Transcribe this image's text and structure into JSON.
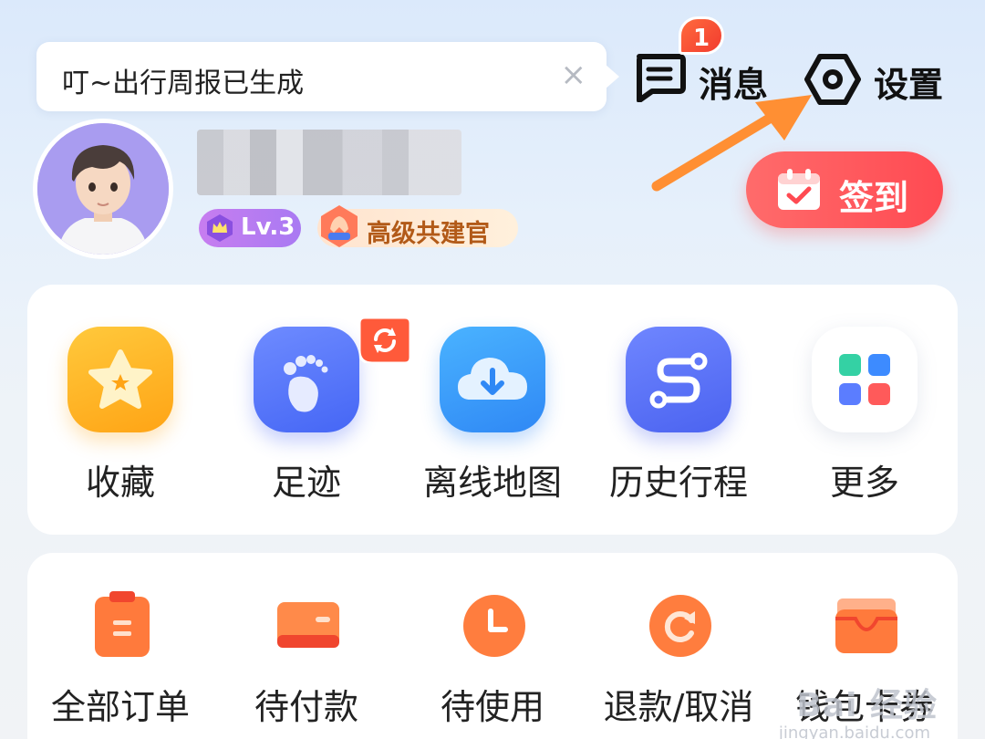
{
  "toast": {
    "text": "叮~出行周报已生成",
    "close": "×"
  },
  "header": {
    "messages": {
      "label": "消息",
      "badge": "1"
    },
    "settings": {
      "label": "设置"
    }
  },
  "profile": {
    "level": "Lv.3",
    "title": "高级共建官"
  },
  "signin": {
    "label": "签到"
  },
  "quick_actions": [
    {
      "label": "收藏",
      "icon": "star-icon"
    },
    {
      "label": "足迹",
      "icon": "footprint-icon"
    },
    {
      "label": "离线地图",
      "icon": "cloud-download-icon"
    },
    {
      "label": "历史行程",
      "icon": "route-icon"
    },
    {
      "label": "更多",
      "icon": "grid-icon"
    }
  ],
  "orders": [
    {
      "label": "全部订单",
      "icon": "clipboard-icon"
    },
    {
      "label": "待付款",
      "icon": "card-icon"
    },
    {
      "label": "待使用",
      "icon": "clock-icon"
    },
    {
      "label": "退款/取消",
      "icon": "refresh-icon"
    },
    {
      "label": "钱包卡券",
      "icon": "wallet-icon"
    }
  ],
  "watermark": {
    "main": "Bai 经验",
    "sub": "jingyan.baidu.com"
  },
  "colors": {
    "accent_red": "#ff4a52",
    "badge_purple": "#b07cf2",
    "orange": "#ff7a2f",
    "arrow": "#ff8f33"
  }
}
